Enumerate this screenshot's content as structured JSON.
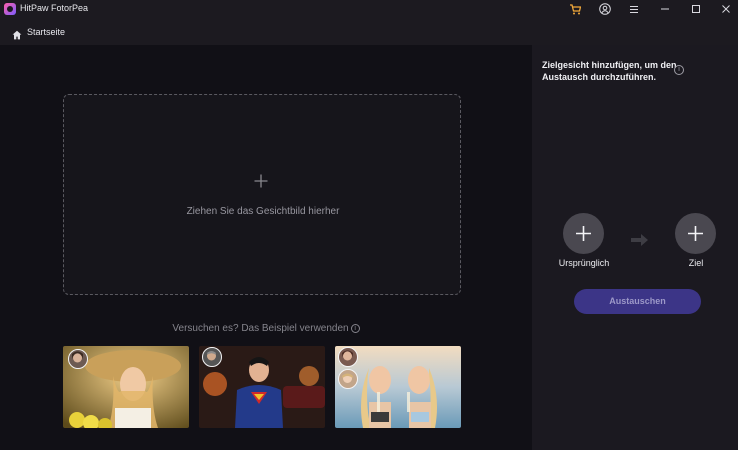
{
  "window": {
    "title": "HitPaw FotorPea",
    "icons": [
      "cart-icon",
      "account-icon",
      "menu-icon",
      "minimize-icon",
      "maximize-icon",
      "close-icon"
    ]
  },
  "nav": {
    "home_label": "Startseite"
  },
  "dropzone": {
    "text": "Ziehen Sie das Gesichtbild hierher"
  },
  "examples": {
    "prompt": "Versuchen es? Das Beispiel verwenden"
  },
  "panel": {
    "title": "Zielgesicht hinzufügen, um den Austausch durchzuführen.",
    "original_label": "Ursprünglich",
    "target_label": "Ziel",
    "swap_label": "Austauschen"
  },
  "colors": {
    "accent": "#3c3587",
    "panel_bg": "#1b1920",
    "main_bg": "#111016"
  }
}
